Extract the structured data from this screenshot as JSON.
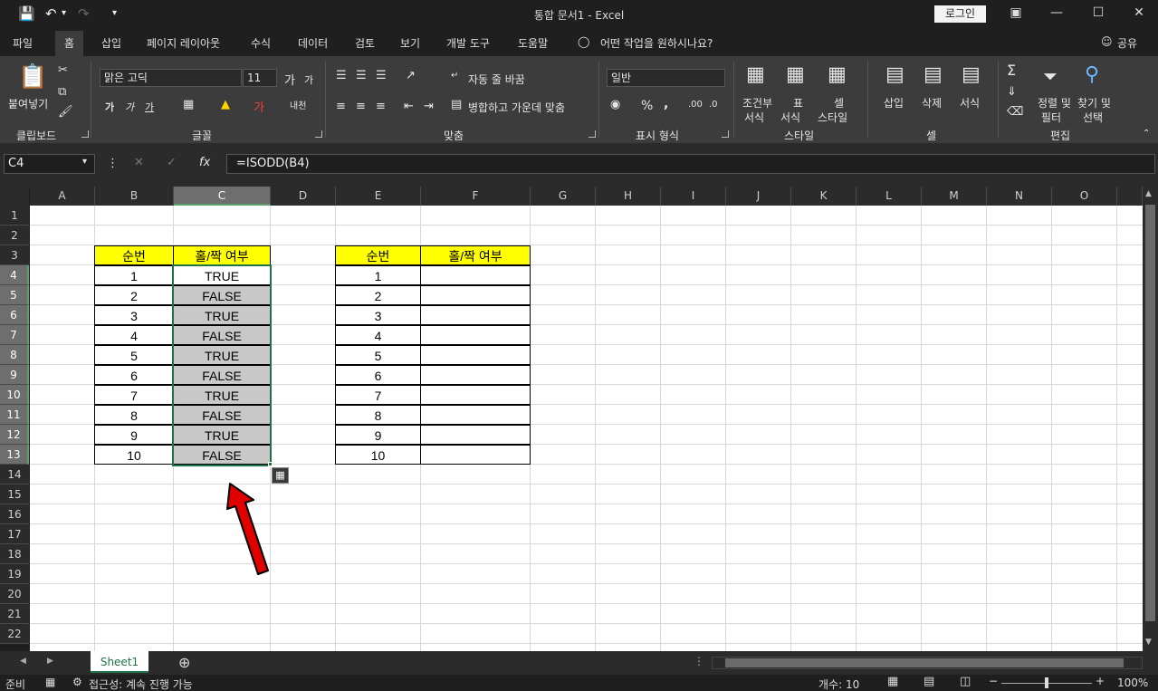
{
  "title": "통합 문서1  -  Excel",
  "login_label": "로그인",
  "tabs": [
    "파일",
    "홈",
    "삽입",
    "페이지 레이아웃",
    "수식",
    "데이터",
    "검토",
    "보기",
    "개발 도구",
    "도움말"
  ],
  "active_tab": "홈",
  "search_prompt": "어떤 작업을 원하시나요?",
  "share_label": "공유",
  "ribbon": {
    "clipboard": {
      "paste": "붙여넣기",
      "group": "클립보드"
    },
    "font": {
      "name": "맑은 고딕",
      "size": "11",
      "group": "글꼴"
    },
    "alignment": {
      "wrap": "자동 줄 바꿈",
      "merge": "병합하고 가운데 맞춤",
      "group": "맞춤"
    },
    "number": {
      "format": "일반",
      "percent": "%",
      "comma": ",",
      "group": "표시 형식"
    },
    "styles": {
      "cond1": "조건부",
      "cond2": "서식",
      "table1": "표",
      "table2": "서식",
      "cell1": "셀",
      "cell2": "스타일",
      "group": "스타일"
    },
    "cells": {
      "insert": "삽입",
      "delete": "삭제",
      "format": "서식",
      "group": "셀"
    },
    "editing": {
      "sort1": "정렬 및",
      "sort2": "필터",
      "find1": "찾기 및",
      "find2": "선택",
      "group": "편집"
    }
  },
  "namebox": "C4",
  "formula": "=ISODD(B4)",
  "columns": [
    "A",
    "B",
    "C",
    "D",
    "E",
    "F",
    "G",
    "H",
    "I",
    "J",
    "K",
    "L",
    "M",
    "N",
    "O"
  ],
  "rows": [
    "1",
    "2",
    "3",
    "4",
    "5",
    "6",
    "7",
    "8",
    "9",
    "10",
    "11",
    "12",
    "13",
    "14",
    "15",
    "16",
    "17",
    "18",
    "19",
    "20",
    "21",
    "22"
  ],
  "table1": {
    "header": [
      "순번",
      "홀/짝 여부"
    ],
    "nums": [
      "1",
      "2",
      "3",
      "4",
      "5",
      "6",
      "7",
      "8",
      "9",
      "10"
    ],
    "vals": [
      "TRUE",
      "FALSE",
      "TRUE",
      "FALSE",
      "TRUE",
      "FALSE",
      "TRUE",
      "FALSE",
      "TRUE",
      "FALSE"
    ]
  },
  "table2": {
    "header": [
      "순번",
      "홀/짝 여부"
    ],
    "nums": [
      "1",
      "2",
      "3",
      "4",
      "5",
      "6",
      "7",
      "8",
      "9",
      "10"
    ]
  },
  "sheet_tab": "Sheet1",
  "status": {
    "ready": "준비",
    "accessibility": "접근성: 계속 진행 가능",
    "count": "개수: 10",
    "zoom": "100%"
  },
  "colors": {
    "accent": "#217346",
    "header_fill": "#ffff00",
    "arrow": "#e00000"
  }
}
